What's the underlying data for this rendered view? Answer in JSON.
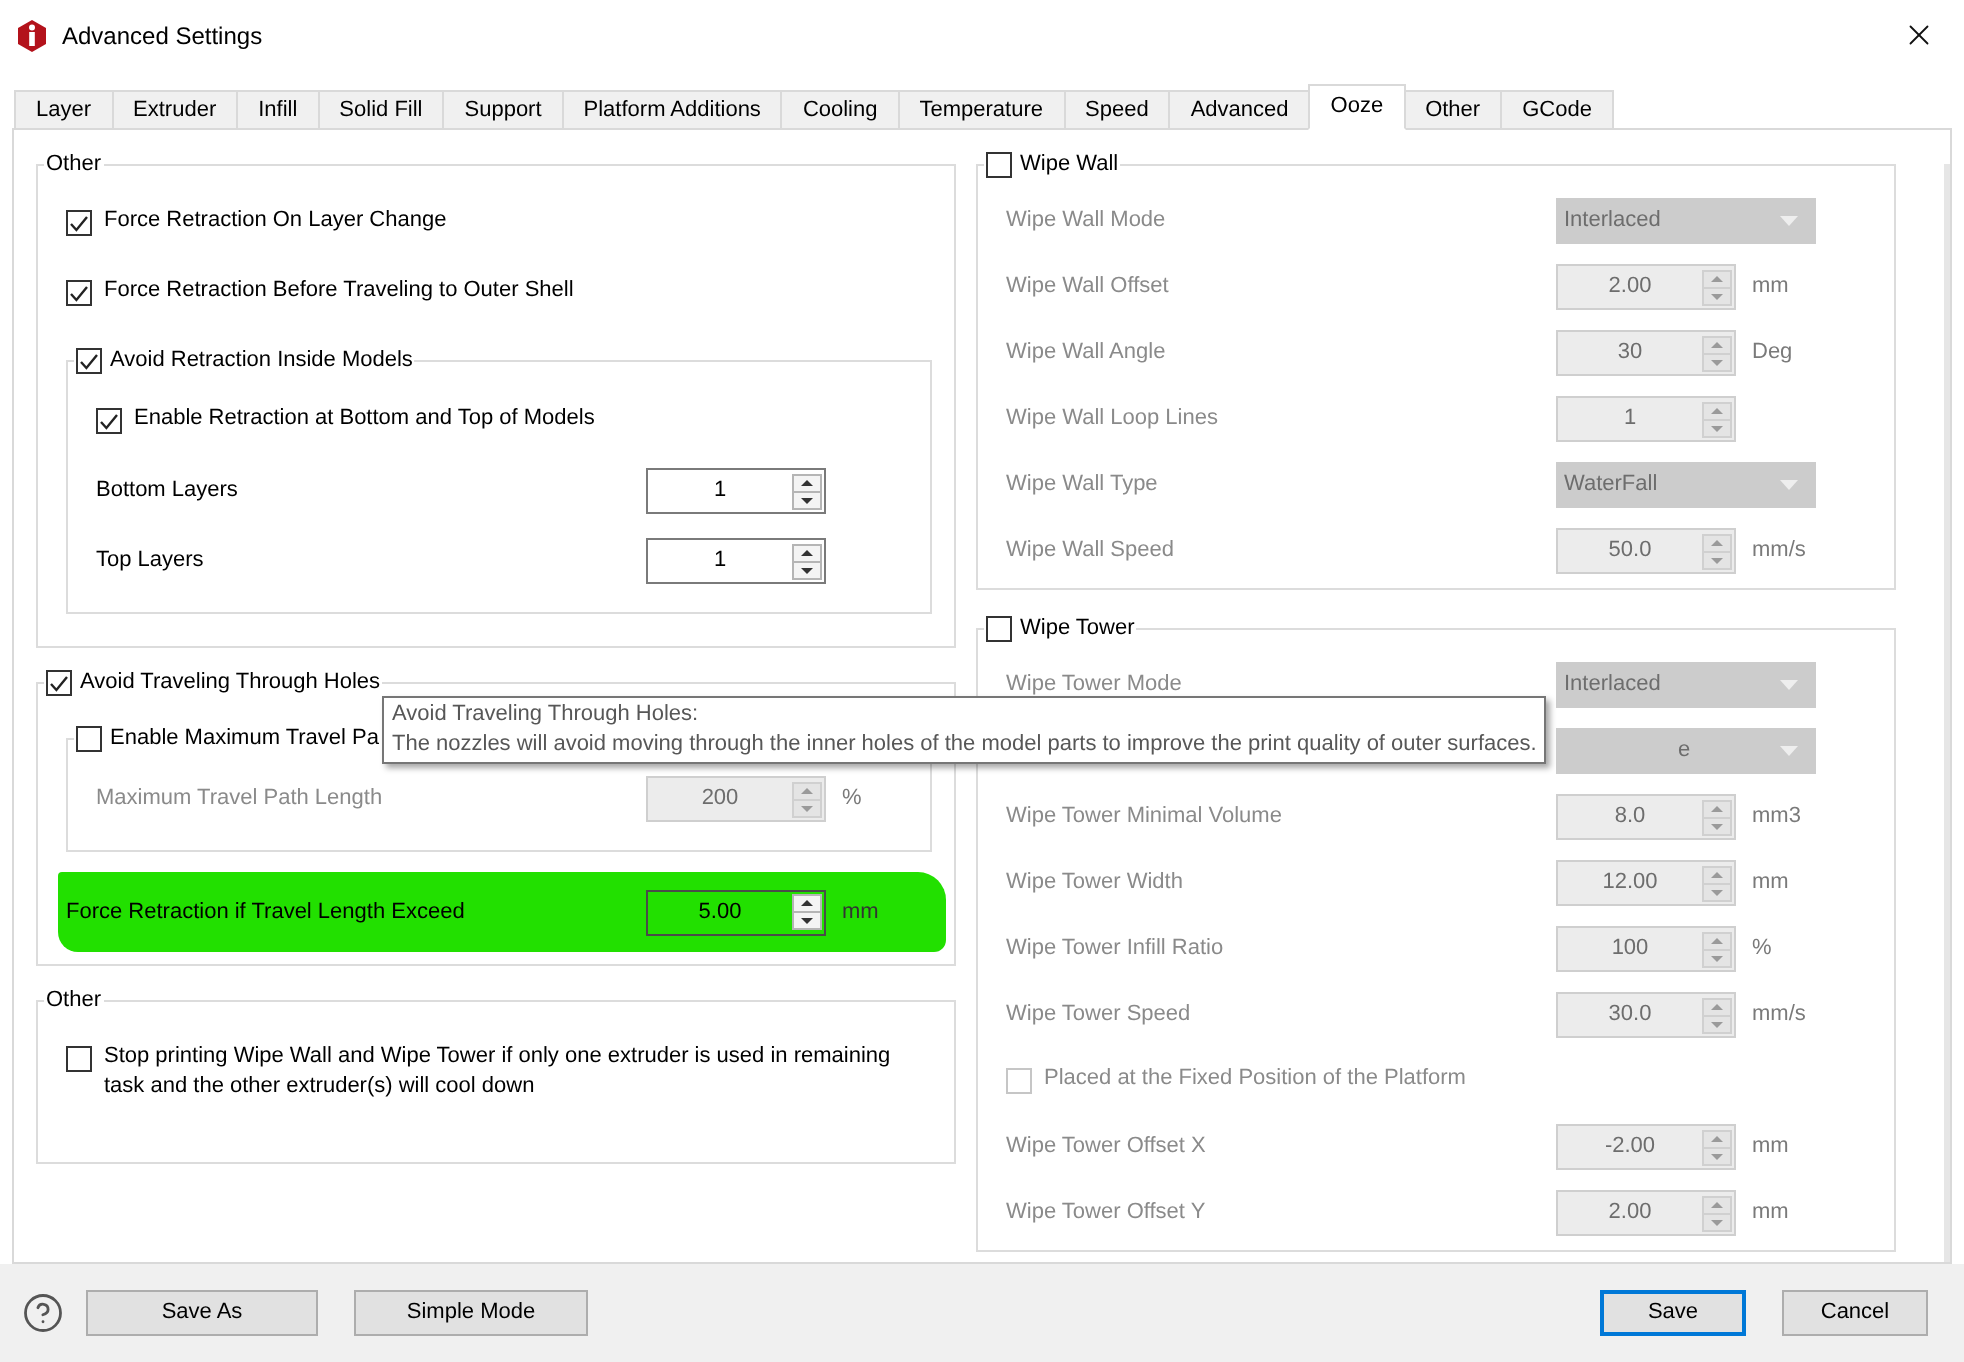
{
  "window": {
    "title": "Advanced Settings"
  },
  "tabs": [
    {
      "label": "Layer",
      "selected": false
    },
    {
      "label": "Extruder",
      "selected": false
    },
    {
      "label": "Infill",
      "selected": false
    },
    {
      "label": "Solid Fill",
      "selected": false
    },
    {
      "label": "Support",
      "selected": false
    },
    {
      "label": "Platform Additions",
      "selected": false
    },
    {
      "label": "Cooling",
      "selected": false
    },
    {
      "label": "Temperature",
      "selected": false
    },
    {
      "label": "Speed",
      "selected": false
    },
    {
      "label": "Advanced",
      "selected": false
    },
    {
      "label": "Ooze",
      "selected": true
    },
    {
      "label": "Other",
      "selected": false
    },
    {
      "label": "GCode",
      "selected": false
    }
  ],
  "left": [
    {
      "title": "Other",
      "items": [
        {
          "kind": "checkbox",
          "label": "Force Retraction On Layer Change",
          "checked": true,
          "disabled": false
        },
        {
          "kind": "checkbox",
          "label": "Force Retraction Before Traveling to Outer Shell",
          "checked": true,
          "disabled": false
        },
        {
          "kind": "group",
          "title": "Avoid Retraction Inside Models",
          "checked": true,
          "items": [
            {
              "kind": "checkbox",
              "label": "Enable Retraction at Bottom and Top of Models",
              "checked": true,
              "disabled": false
            },
            {
              "kind": "spin",
              "label": "Bottom Layers",
              "value": "1",
              "disabled": false
            },
            {
              "kind": "spin",
              "label": "Top Layers",
              "value": "1",
              "disabled": false
            }
          ]
        }
      ]
    },
    {
      "title": "Avoid Traveling Through Holes",
      "checked": true,
      "items": [
        {
          "kind": "group",
          "title": "Enable Maximum Travel Pa",
          "checked": false,
          "items": [
            {
              "kind": "spin",
              "label": "Maximum Travel Path Length",
              "value": "200",
              "unit": "%",
              "disabled": true
            }
          ]
        },
        {
          "kind": "spin",
          "label": "Force Retraction if Travel Length Exceed",
          "value": "5.00",
          "unit": "mm",
          "disabled": false,
          "highlighted": true
        }
      ]
    },
    {
      "title": "Other",
      "items": [
        {
          "kind": "checkbox",
          "label": "Stop printing Wipe Wall and Wipe Tower if only one extruder is used in remaining task and the other extruder(s) will cool down",
          "checked": false,
          "disabled": false
        }
      ]
    }
  ],
  "right": [
    {
      "title": "Wipe Wall",
      "checked": false,
      "items": [
        {
          "kind": "dropdown",
          "label": "Wipe Wall Mode",
          "value": "Interlaced",
          "disabled": true
        },
        {
          "kind": "spin",
          "label": "Wipe Wall Offset",
          "value": "2.00",
          "unit": "mm",
          "disabled": true
        },
        {
          "kind": "spin",
          "label": "Wipe Wall Angle",
          "value": "30",
          "unit": "Deg",
          "disabled": true
        },
        {
          "kind": "spin",
          "label": "Wipe Wall Loop Lines",
          "value": "1",
          "disabled": true
        },
        {
          "kind": "dropdown",
          "label": "Wipe Wall Type",
          "value": "WaterFall",
          "disabled": true
        },
        {
          "kind": "spin",
          "label": "Wipe Wall Speed",
          "value": "50.0",
          "unit": "mm/s",
          "disabled": true
        }
      ]
    },
    {
      "title": "Wipe Tower",
      "checked": false,
      "items": [
        {
          "kind": "dropdown",
          "label": "Wipe Tower Mode",
          "value": "Interlaced",
          "disabled": true
        },
        {
          "kind": "dropdown",
          "value": "e",
          "disabled": true
        },
        {
          "kind": "spin",
          "label": "Wipe Tower Minimal Volume",
          "value": "8.0",
          "unit": "mm3",
          "disabled": true
        },
        {
          "kind": "spin",
          "label": "Wipe Tower Width",
          "value": "12.00",
          "unit": "mm",
          "disabled": true
        },
        {
          "kind": "spin",
          "label": "Wipe Tower Infill Ratio",
          "value": "100",
          "unit": "%",
          "disabled": true
        },
        {
          "kind": "spin",
          "label": "Wipe Tower Speed",
          "value": "30.0",
          "unit": "mm/s",
          "disabled": true
        },
        {
          "kind": "checkbox",
          "label": "Placed at the Fixed Position of the Platform",
          "checked": false,
          "disabled": true
        },
        {
          "kind": "spin",
          "label": "Wipe Tower Offset X",
          "value": "-2.00",
          "unit": "mm",
          "disabled": true
        },
        {
          "kind": "spin",
          "label": "Wipe Tower Offset Y",
          "value": "2.00",
          "unit": "mm",
          "disabled": true
        }
      ]
    }
  ],
  "tooltip": {
    "title": "Avoid Traveling Through Holes:",
    "text": "The nozzles will avoid moving through the inner holes of the model parts to improve the print quality of outer surfaces."
  },
  "buttons": [
    {
      "label": "Save As",
      "default": false
    },
    {
      "label": "Simple Mode",
      "default": false
    }
  ],
  "dialog_buttons": [
    {
      "label": "Save",
      "default": true
    },
    {
      "label": "Cancel",
      "default": false
    }
  ]
}
